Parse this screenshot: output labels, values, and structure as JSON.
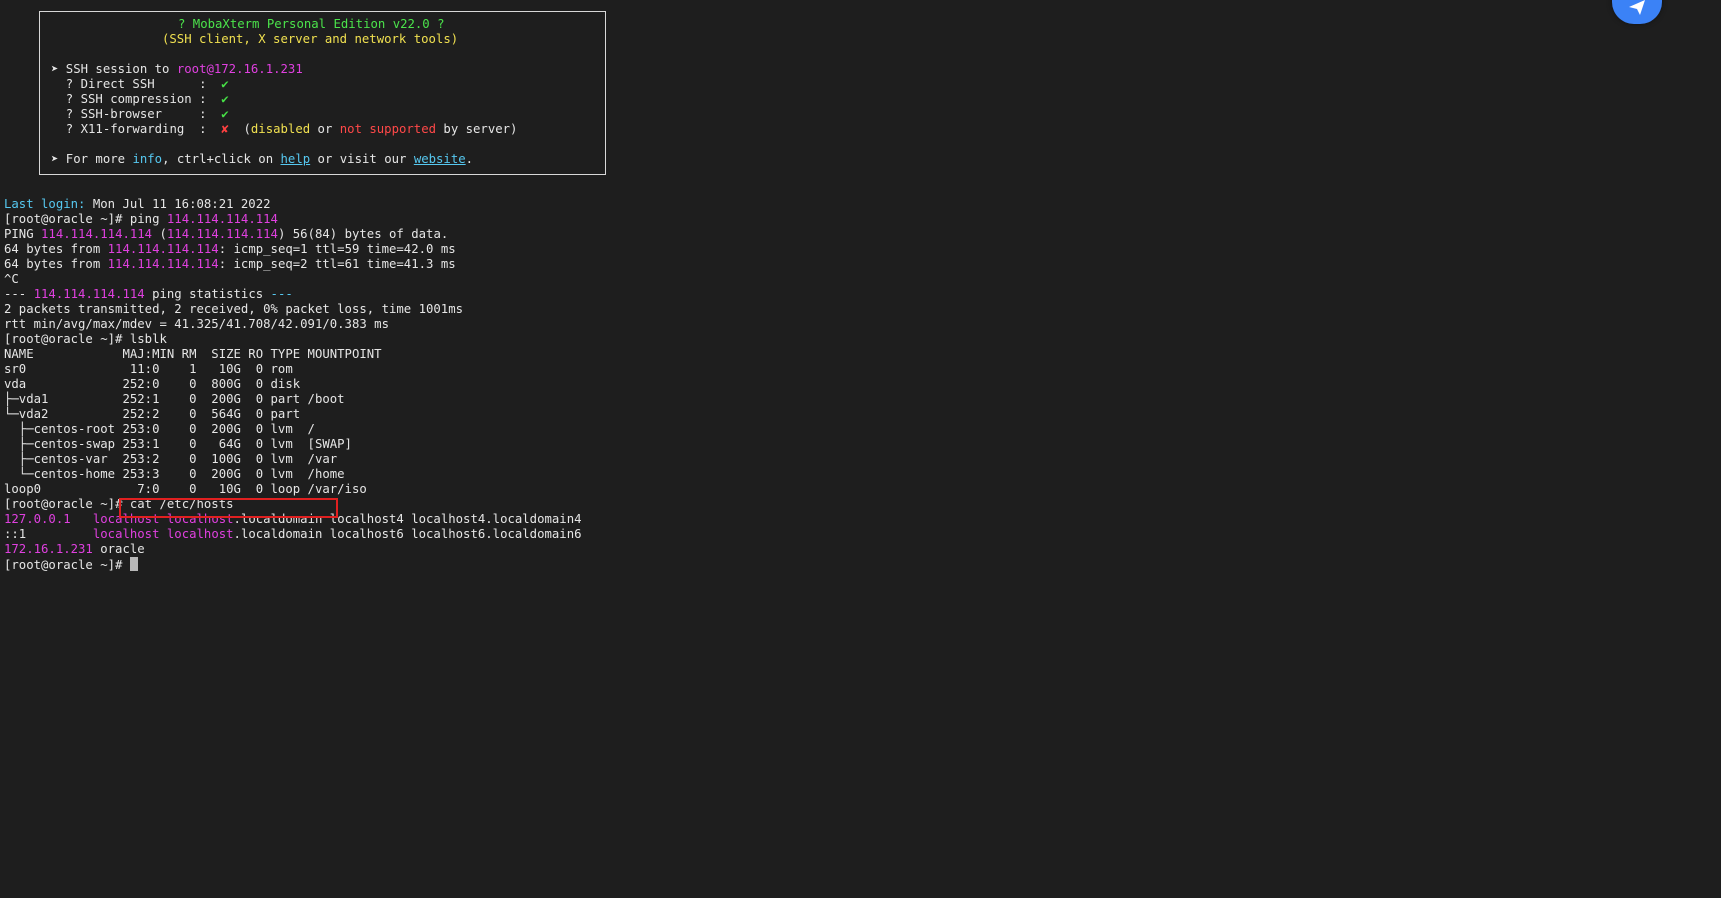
{
  "banner": {
    "title": "? MobaXterm Personal Edition v22.0 ?",
    "subtitle": "(SSH client, X server and network tools)",
    "session_prefix": "➤ SSH session to ",
    "session_target": "root@172.16.1.231",
    "rows": [
      {
        "label": "  ? Direct SSH      :  ",
        "mark": "✔"
      },
      {
        "label": "  ? SSH compression :  ",
        "mark": "✔"
      },
      {
        "label": "  ? SSH-browser     :  ",
        "mark": "✔"
      }
    ],
    "x11": {
      "label": "  ? X11-forwarding  :  ",
      "mark": "✘",
      "open": "  (",
      "disabled": "disabled",
      "or": " or ",
      "not_supported": "not supported",
      "tail": " by server)"
    },
    "footer": {
      "prefix": "➤ For more ",
      "info": "info",
      "mid1": ", ctrl+click on ",
      "help": "help",
      "mid2": " or visit our ",
      "website": "website",
      "end": "."
    }
  },
  "terminal": {
    "last_login_label": "Last login:",
    "last_login_value": " Mon Jul 11 16:08:21 2022",
    "prompt": "[root@oracle ~]# ",
    "ping_cmd": "ping ",
    "ping_ip": "114.114.114.114",
    "ping_header_a": "PING ",
    "ping_header_b": " (",
    "ping_header_c": ") 56(84) bytes of data.",
    "reply1_a": "64 bytes from ",
    "reply1_b": ": icmp_seq=1 ttl=59 time=42.0 ms",
    "reply2_a": "64 bytes from ",
    "reply2_b": ": icmp_seq=2 ttl=61 time=41.3 ms",
    "interrupt": "^C",
    "stats_a": "--- ",
    "stats_b": " ping statistics ",
    "stats_c": "---",
    "stats_line1": "2 packets transmitted, 2 received, 0% packet loss, time 1001ms",
    "stats_line2": "rtt min/avg/max/mdev = 41.325/41.708/42.091/0.383 ms",
    "lsblk_cmd": "lsblk",
    "lsblk_lines": [
      "NAME            MAJ:MIN RM  SIZE RO TYPE MOUNTPOINT",
      "sr0              11:0    1   10G  0 rom",
      "vda             252:0    0  800G  0 disk",
      "├─vda1          252:1    0  200G  0 part /boot",
      "└─vda2          252:2    0  564G  0 part",
      "  ├─centos-root 253:0    0  200G  0 lvm  /",
      "  ├─centos-swap 253:1    0   64G  0 lvm  [SWAP]",
      "  ├─centos-var  253:2    0  100G  0 lvm  /var",
      "  └─centos-home 253:3    0  200G  0 lvm  /home",
      "loop0             7:0    0   10G  0 loop /var/iso"
    ],
    "cat_prompt": "[root@oracle ~]",
    "cat_cmd": "# cat /etc/hosts",
    "hosts": [
      {
        "ip": "127.0.0.1",
        "pad": "   ",
        "h1": "localhost",
        "sp": " ",
        "h2": "localhost",
        "rest": ".localdomain localhost4 localhost4.localdomain4"
      },
      {
        "ip": "::1",
        "pad": "         ",
        "h1": "localhost",
        "sp": " ",
        "h2": "localhost",
        "rest": ".localdomain localhost6 localhost6.localdomain6"
      }
    ],
    "hosts_last_ip": "172.16.1.231",
    "hosts_last_name": " oracle",
    "final_prompt": "[root@oracle ~]# "
  },
  "colors": {
    "background": "#1e1e1e",
    "magenta": "#e040e0",
    "green": "#4be34b",
    "yellow": "#f0e050",
    "cyan": "#56c8f0",
    "red": "#ff4848",
    "highlight_box": "#e02020",
    "float_button": "#3b82f6"
  },
  "icons": {
    "floating_button": "send-arrow-icon"
  }
}
